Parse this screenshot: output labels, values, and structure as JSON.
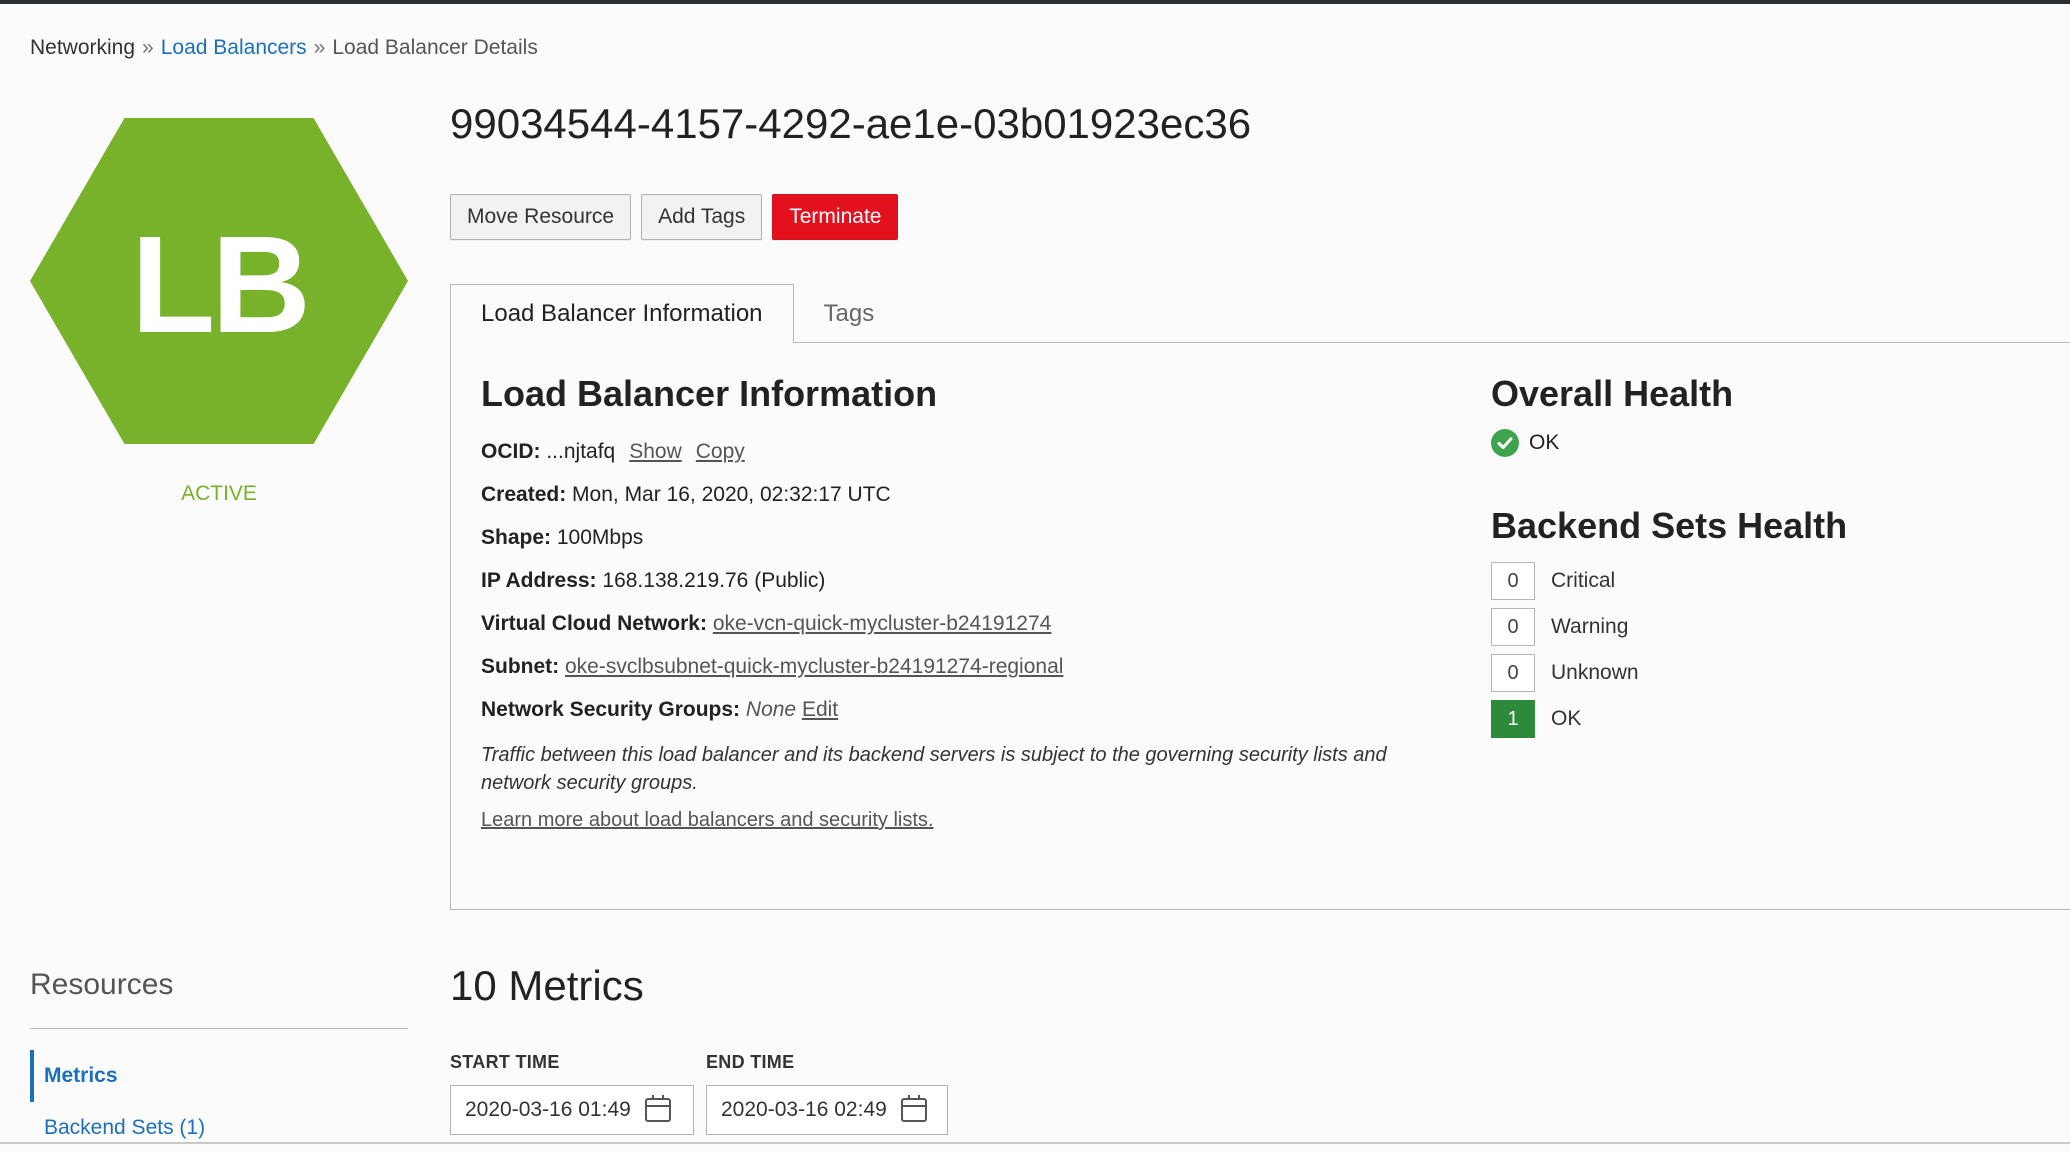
{
  "breadcrumb": {
    "root": "Networking",
    "separator": "»",
    "link": "Load Balancers",
    "current": "Load Balancer Details"
  },
  "badge": {
    "text": "LB",
    "state": "ACTIVE",
    "color": "#77b22a"
  },
  "title": "99034544-4157-4292-ae1e-03b01923ec36",
  "actions": {
    "move": "Move Resource",
    "tags": "Add Tags",
    "terminate": "Terminate",
    "terminate_color": "#e3111e"
  },
  "tabs": {
    "info": "Load Balancer Information",
    "tags": "Tags"
  },
  "info": {
    "heading": "Load Balancer Information",
    "ocid_label": "OCID:",
    "ocid_value": "...njtafq",
    "show": "Show",
    "copy": "Copy",
    "created_label": "Created:",
    "created_value": "Mon, Mar 16, 2020, 02:32:17 UTC",
    "shape_label": "Shape:",
    "shape_value": "100Mbps",
    "ip_label": "IP Address:",
    "ip_value": "168.138.219.76 (Public)",
    "vcn_label": "Virtual Cloud Network:",
    "vcn_value": "oke-vcn-quick-mycluster-b24191274",
    "subnet_label": "Subnet:",
    "subnet_value": "oke-svclbsubnet-quick-mycluster-b24191274-regional",
    "nsg_label": "Network Security Groups:",
    "nsg_value": "None",
    "nsg_edit": "Edit",
    "note": "Traffic between this load balancer and its backend servers is subject to the governing security lists and network security groups.",
    "learn_more": "Learn more about load balancers and security lists."
  },
  "health": {
    "overall_heading": "Overall Health",
    "overall_status": "OK",
    "ok_color": "#3fa34d",
    "backend_heading": "Backend Sets Health",
    "rows": [
      {
        "count": "0",
        "label": "Critical"
      },
      {
        "count": "0",
        "label": "Warning"
      },
      {
        "count": "0",
        "label": "Unknown"
      },
      {
        "count": "1",
        "label": "OK"
      }
    ],
    "filled_color": "#2e8a3b"
  },
  "resources": {
    "title": "Resources",
    "items": [
      "Metrics",
      "Backend Sets (1)"
    ]
  },
  "metrics": {
    "title": "10 Metrics",
    "start_label": "START TIME",
    "start_value": "2020-03-16 01:49",
    "end_label": "END TIME",
    "end_value": "2020-03-16 02:49"
  }
}
